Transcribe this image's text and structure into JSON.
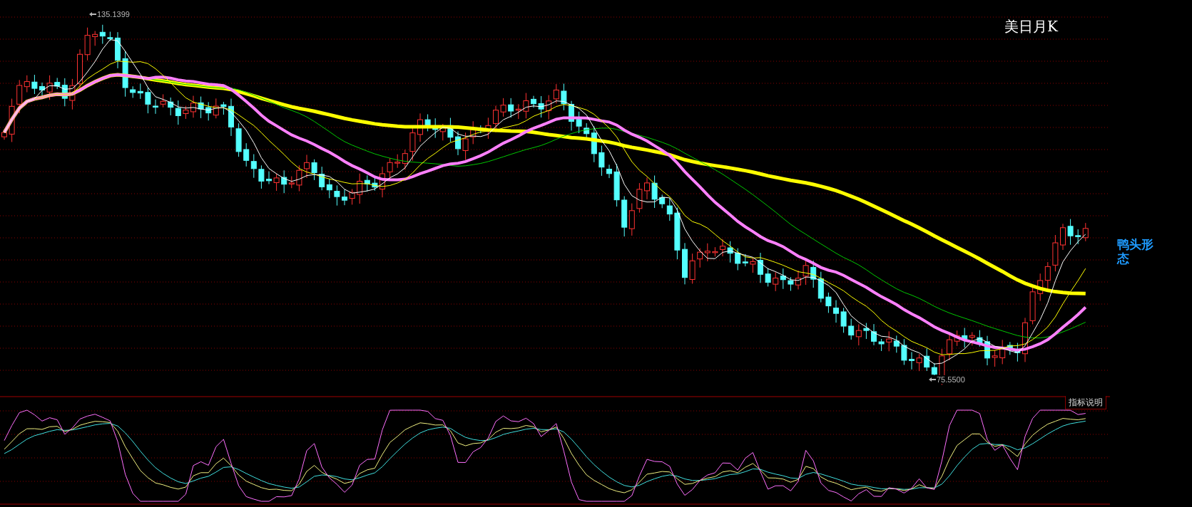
{
  "chart": {
    "title": "美日月K",
    "high_label": "135.1399",
    "low_label": "75.5500",
    "pattern_label": "鸭头形态"
  },
  "indicator_panel": {
    "button": "指标说明"
  }
}
